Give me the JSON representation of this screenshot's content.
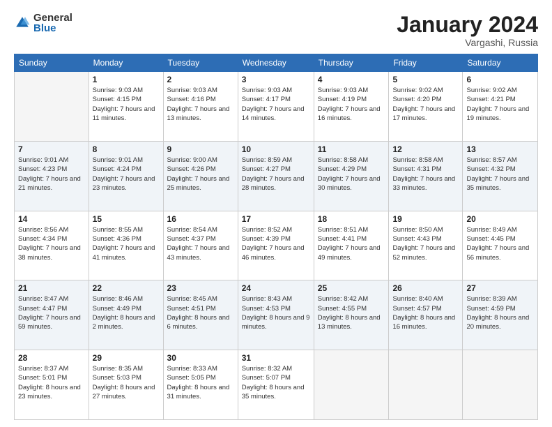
{
  "header": {
    "logo_general": "General",
    "logo_blue": "Blue",
    "month_title": "January 2024",
    "location": "Vargashi, Russia"
  },
  "days_of_week": [
    "Sunday",
    "Monday",
    "Tuesday",
    "Wednesday",
    "Thursday",
    "Friday",
    "Saturday"
  ],
  "weeks": [
    [
      {
        "day": "",
        "sunrise": "",
        "sunset": "",
        "daylight": "",
        "empty": true
      },
      {
        "day": "1",
        "sunrise": "Sunrise: 9:03 AM",
        "sunset": "Sunset: 4:15 PM",
        "daylight": "Daylight: 7 hours and 11 minutes."
      },
      {
        "day": "2",
        "sunrise": "Sunrise: 9:03 AM",
        "sunset": "Sunset: 4:16 PM",
        "daylight": "Daylight: 7 hours and 13 minutes."
      },
      {
        "day": "3",
        "sunrise": "Sunrise: 9:03 AM",
        "sunset": "Sunset: 4:17 PM",
        "daylight": "Daylight: 7 hours and 14 minutes."
      },
      {
        "day": "4",
        "sunrise": "Sunrise: 9:03 AM",
        "sunset": "Sunset: 4:19 PM",
        "daylight": "Daylight: 7 hours and 16 minutes."
      },
      {
        "day": "5",
        "sunrise": "Sunrise: 9:02 AM",
        "sunset": "Sunset: 4:20 PM",
        "daylight": "Daylight: 7 hours and 17 minutes."
      },
      {
        "day": "6",
        "sunrise": "Sunrise: 9:02 AM",
        "sunset": "Sunset: 4:21 PM",
        "daylight": "Daylight: 7 hours and 19 minutes."
      }
    ],
    [
      {
        "day": "7",
        "sunrise": "Sunrise: 9:01 AM",
        "sunset": "Sunset: 4:23 PM",
        "daylight": "Daylight: 7 hours and 21 minutes."
      },
      {
        "day": "8",
        "sunrise": "Sunrise: 9:01 AM",
        "sunset": "Sunset: 4:24 PM",
        "daylight": "Daylight: 7 hours and 23 minutes."
      },
      {
        "day": "9",
        "sunrise": "Sunrise: 9:00 AM",
        "sunset": "Sunset: 4:26 PM",
        "daylight": "Daylight: 7 hours and 25 minutes."
      },
      {
        "day": "10",
        "sunrise": "Sunrise: 8:59 AM",
        "sunset": "Sunset: 4:27 PM",
        "daylight": "Daylight: 7 hours and 28 minutes."
      },
      {
        "day": "11",
        "sunrise": "Sunrise: 8:58 AM",
        "sunset": "Sunset: 4:29 PM",
        "daylight": "Daylight: 7 hours and 30 minutes."
      },
      {
        "day": "12",
        "sunrise": "Sunrise: 8:58 AM",
        "sunset": "Sunset: 4:31 PM",
        "daylight": "Daylight: 7 hours and 33 minutes."
      },
      {
        "day": "13",
        "sunrise": "Sunrise: 8:57 AM",
        "sunset": "Sunset: 4:32 PM",
        "daylight": "Daylight: 7 hours and 35 minutes."
      }
    ],
    [
      {
        "day": "14",
        "sunrise": "Sunrise: 8:56 AM",
        "sunset": "Sunset: 4:34 PM",
        "daylight": "Daylight: 7 hours and 38 minutes."
      },
      {
        "day": "15",
        "sunrise": "Sunrise: 8:55 AM",
        "sunset": "Sunset: 4:36 PM",
        "daylight": "Daylight: 7 hours and 41 minutes."
      },
      {
        "day": "16",
        "sunrise": "Sunrise: 8:54 AM",
        "sunset": "Sunset: 4:37 PM",
        "daylight": "Daylight: 7 hours and 43 minutes."
      },
      {
        "day": "17",
        "sunrise": "Sunrise: 8:52 AM",
        "sunset": "Sunset: 4:39 PM",
        "daylight": "Daylight: 7 hours and 46 minutes."
      },
      {
        "day": "18",
        "sunrise": "Sunrise: 8:51 AM",
        "sunset": "Sunset: 4:41 PM",
        "daylight": "Daylight: 7 hours and 49 minutes."
      },
      {
        "day": "19",
        "sunrise": "Sunrise: 8:50 AM",
        "sunset": "Sunset: 4:43 PM",
        "daylight": "Daylight: 7 hours and 52 minutes."
      },
      {
        "day": "20",
        "sunrise": "Sunrise: 8:49 AM",
        "sunset": "Sunset: 4:45 PM",
        "daylight": "Daylight: 7 hours and 56 minutes."
      }
    ],
    [
      {
        "day": "21",
        "sunrise": "Sunrise: 8:47 AM",
        "sunset": "Sunset: 4:47 PM",
        "daylight": "Daylight: 7 hours and 59 minutes."
      },
      {
        "day": "22",
        "sunrise": "Sunrise: 8:46 AM",
        "sunset": "Sunset: 4:49 PM",
        "daylight": "Daylight: 8 hours and 2 minutes."
      },
      {
        "day": "23",
        "sunrise": "Sunrise: 8:45 AM",
        "sunset": "Sunset: 4:51 PM",
        "daylight": "Daylight: 8 hours and 6 minutes."
      },
      {
        "day": "24",
        "sunrise": "Sunrise: 8:43 AM",
        "sunset": "Sunset: 4:53 PM",
        "daylight": "Daylight: 8 hours and 9 minutes."
      },
      {
        "day": "25",
        "sunrise": "Sunrise: 8:42 AM",
        "sunset": "Sunset: 4:55 PM",
        "daylight": "Daylight: 8 hours and 13 minutes."
      },
      {
        "day": "26",
        "sunrise": "Sunrise: 8:40 AM",
        "sunset": "Sunset: 4:57 PM",
        "daylight": "Daylight: 8 hours and 16 minutes."
      },
      {
        "day": "27",
        "sunrise": "Sunrise: 8:39 AM",
        "sunset": "Sunset: 4:59 PM",
        "daylight": "Daylight: 8 hours and 20 minutes."
      }
    ],
    [
      {
        "day": "28",
        "sunrise": "Sunrise: 8:37 AM",
        "sunset": "Sunset: 5:01 PM",
        "daylight": "Daylight: 8 hours and 23 minutes."
      },
      {
        "day": "29",
        "sunrise": "Sunrise: 8:35 AM",
        "sunset": "Sunset: 5:03 PM",
        "daylight": "Daylight: 8 hours and 27 minutes."
      },
      {
        "day": "30",
        "sunrise": "Sunrise: 8:33 AM",
        "sunset": "Sunset: 5:05 PM",
        "daylight": "Daylight: 8 hours and 31 minutes."
      },
      {
        "day": "31",
        "sunrise": "Sunrise: 8:32 AM",
        "sunset": "Sunset: 5:07 PM",
        "daylight": "Daylight: 8 hours and 35 minutes."
      },
      {
        "day": "",
        "sunrise": "",
        "sunset": "",
        "daylight": "",
        "empty": true
      },
      {
        "day": "",
        "sunrise": "",
        "sunset": "",
        "daylight": "",
        "empty": true
      },
      {
        "day": "",
        "sunrise": "",
        "sunset": "",
        "daylight": "",
        "empty": true
      }
    ]
  ]
}
